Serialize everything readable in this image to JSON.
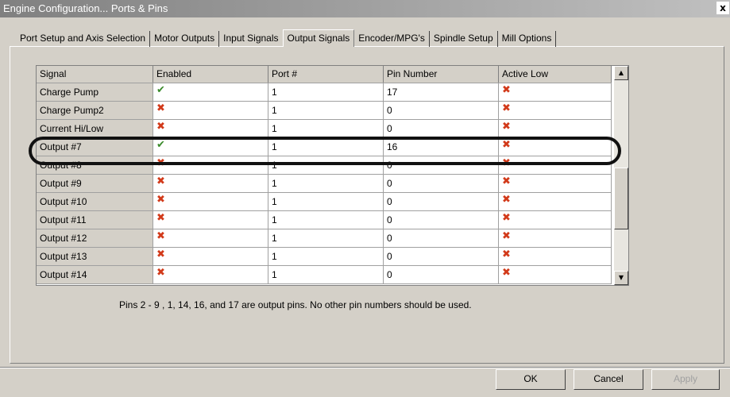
{
  "window": {
    "title": "Engine Configuration... Ports & Pins",
    "close_label": "x"
  },
  "tabs": [
    {
      "label": "Port Setup and Axis Selection"
    },
    {
      "label": "Motor Outputs"
    },
    {
      "label": "Input Signals"
    },
    {
      "label": "Output Signals"
    },
    {
      "label": "Encoder/MPG's"
    },
    {
      "label": "Spindle Setup"
    },
    {
      "label": "Mill Options"
    }
  ],
  "grid": {
    "columns": [
      "Signal",
      "Enabled",
      "Port #",
      "Pin Number",
      "Active Low"
    ],
    "rows": [
      {
        "signal": "Charge Pump",
        "enabled": "check",
        "port": "1",
        "pin": "17",
        "active_low": "cross"
      },
      {
        "signal": "Charge Pump2",
        "enabled": "cross",
        "port": "1",
        "pin": "0",
        "active_low": "cross"
      },
      {
        "signal": "Current Hi/Low",
        "enabled": "cross",
        "port": "1",
        "pin": "0",
        "active_low": "cross"
      },
      {
        "signal": "Output #7",
        "enabled": "check",
        "port": "1",
        "pin": "16",
        "active_low": "cross"
      },
      {
        "signal": "Output #8",
        "enabled": "cross",
        "port": "1",
        "pin": "0",
        "active_low": "cross"
      },
      {
        "signal": "Output #9",
        "enabled": "cross",
        "port": "1",
        "pin": "0",
        "active_low": "cross"
      },
      {
        "signal": "Output #10",
        "enabled": "cross",
        "port": "1",
        "pin": "0",
        "active_low": "cross"
      },
      {
        "signal": "Output #11",
        "enabled": "cross",
        "port": "1",
        "pin": "0",
        "active_low": "cross"
      },
      {
        "signal": "Output #12",
        "enabled": "cross",
        "port": "1",
        "pin": "0",
        "active_low": "cross"
      },
      {
        "signal": "Output #13",
        "enabled": "cross",
        "port": "1",
        "pin": "0",
        "active_low": "cross"
      },
      {
        "signal": "Output #14",
        "enabled": "cross",
        "port": "1",
        "pin": "0",
        "active_low": "cross"
      }
    ]
  },
  "icons": {
    "check": "✔",
    "cross": "✖",
    "scroll_up": "▲",
    "scroll_down": "▼"
  },
  "colors": {
    "check": "#3a8a2a",
    "cross": "#d23a1a"
  },
  "note": "Pins 2 - 9 , 1, 14, 16, and 17 are output pins. No  other pin numbers should be used.",
  "buttons": {
    "ok": "OK",
    "cancel": "Cancel",
    "apply": "Apply"
  }
}
